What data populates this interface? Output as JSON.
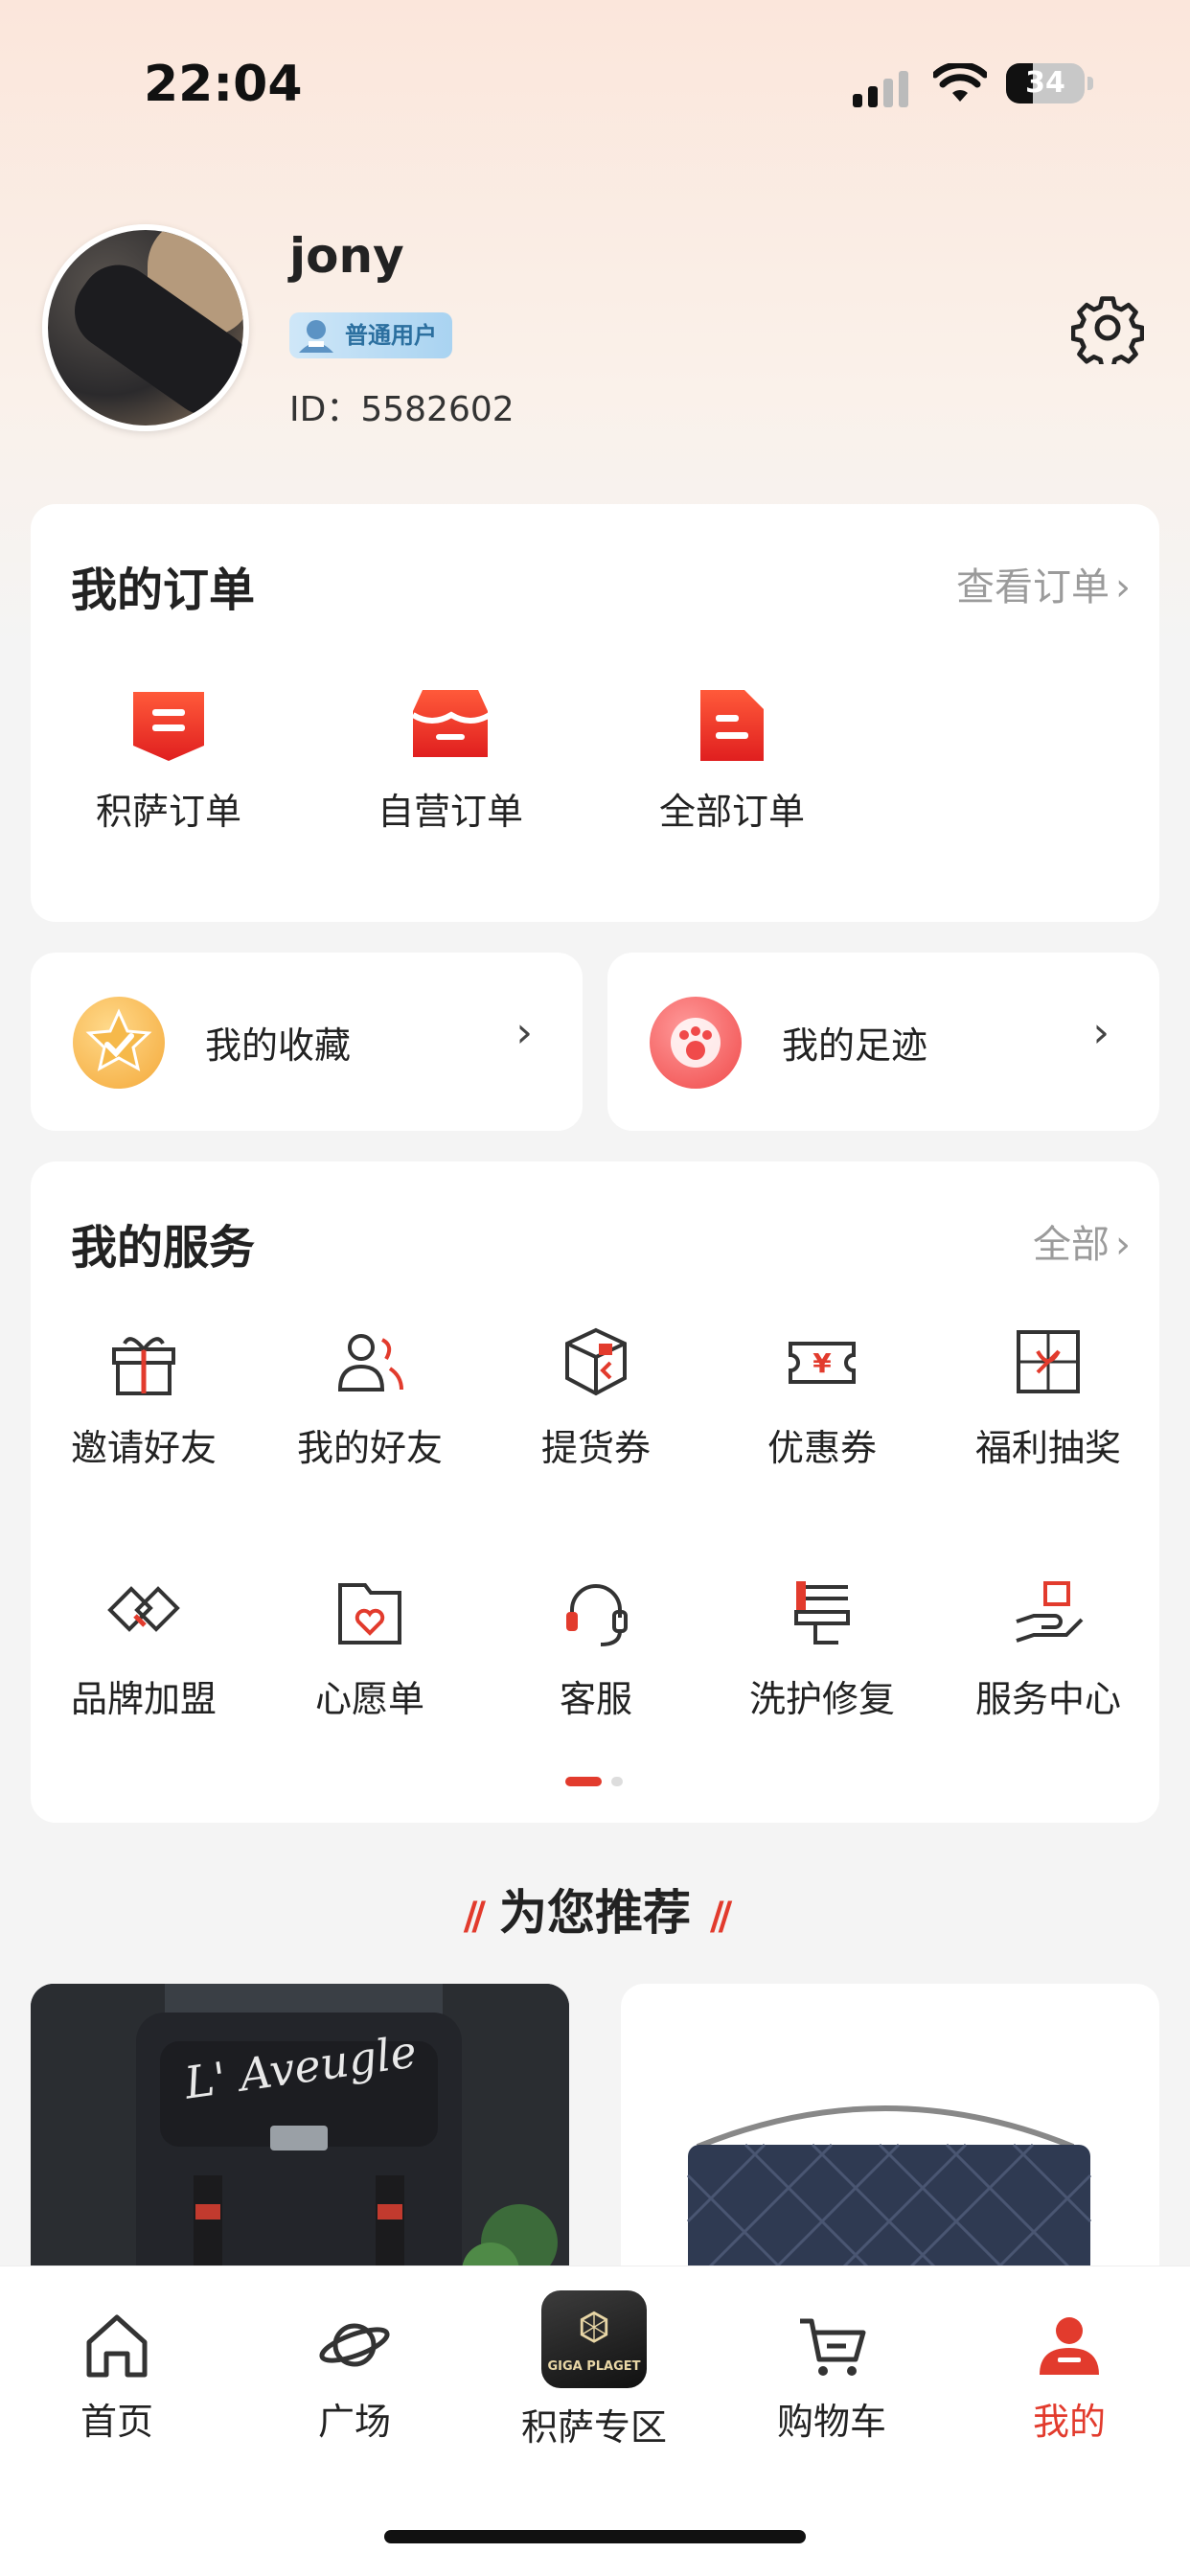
{
  "status_bar": {
    "time": "22:04",
    "battery": "34",
    "battery_level": 0.34
  },
  "profile": {
    "username": "jony",
    "badge": "普通用户",
    "id": "ID：5582602"
  },
  "orders": {
    "title": "我的订单",
    "view_all": "查看订单",
    "items": [
      {
        "label": "积萨订单",
        "icon": "giga-order-icon"
      },
      {
        "label": "自营订单",
        "icon": "self-order-icon"
      },
      {
        "label": "全部订单",
        "icon": "all-orders-icon"
      }
    ]
  },
  "shortcuts": {
    "favorites": {
      "label": "我的收藏",
      "icon": "star-icon"
    },
    "history": {
      "label": "我的足迹",
      "icon": "footprint-icon"
    }
  },
  "services": {
    "title": "我的服务",
    "view_all": "全部",
    "items": [
      {
        "label": "邀请好友",
        "icon": "gift-icon"
      },
      {
        "label": "我的好友",
        "icon": "friends-icon"
      },
      {
        "label": "提货券",
        "icon": "box-icon"
      },
      {
        "label": "优惠券",
        "icon": "coupon-icon"
      },
      {
        "label": "福利抽奖",
        "icon": "lottery-icon"
      },
      {
        "label": "品牌加盟",
        "icon": "handshake-icon"
      },
      {
        "label": "心愿单",
        "icon": "wishlist-icon"
      },
      {
        "label": "客服",
        "icon": "headset-icon"
      },
      {
        "label": "洗护修复",
        "icon": "care-repair-icon"
      },
      {
        "label": "服务中心",
        "icon": "service-center-icon"
      }
    ]
  },
  "recommend": {
    "title": "为您推荐",
    "product1_text": "L' Aveugle"
  },
  "tabbar": {
    "items": [
      {
        "label": "首页",
        "icon": "home-icon"
      },
      {
        "label": "广场",
        "icon": "planet-icon"
      },
      {
        "label": "积萨专区",
        "icon": "giga-planet-icon",
        "logo_text": "GIGA PLAGET"
      },
      {
        "label": "购物车",
        "icon": "cart-icon"
      },
      {
        "label": "我的",
        "icon": "profile-icon"
      }
    ],
    "active_index": 4
  },
  "colors": {
    "accent": "#e23b2d",
    "muted": "#9b9b9b",
    "badge_text": "#2b6f9f"
  }
}
